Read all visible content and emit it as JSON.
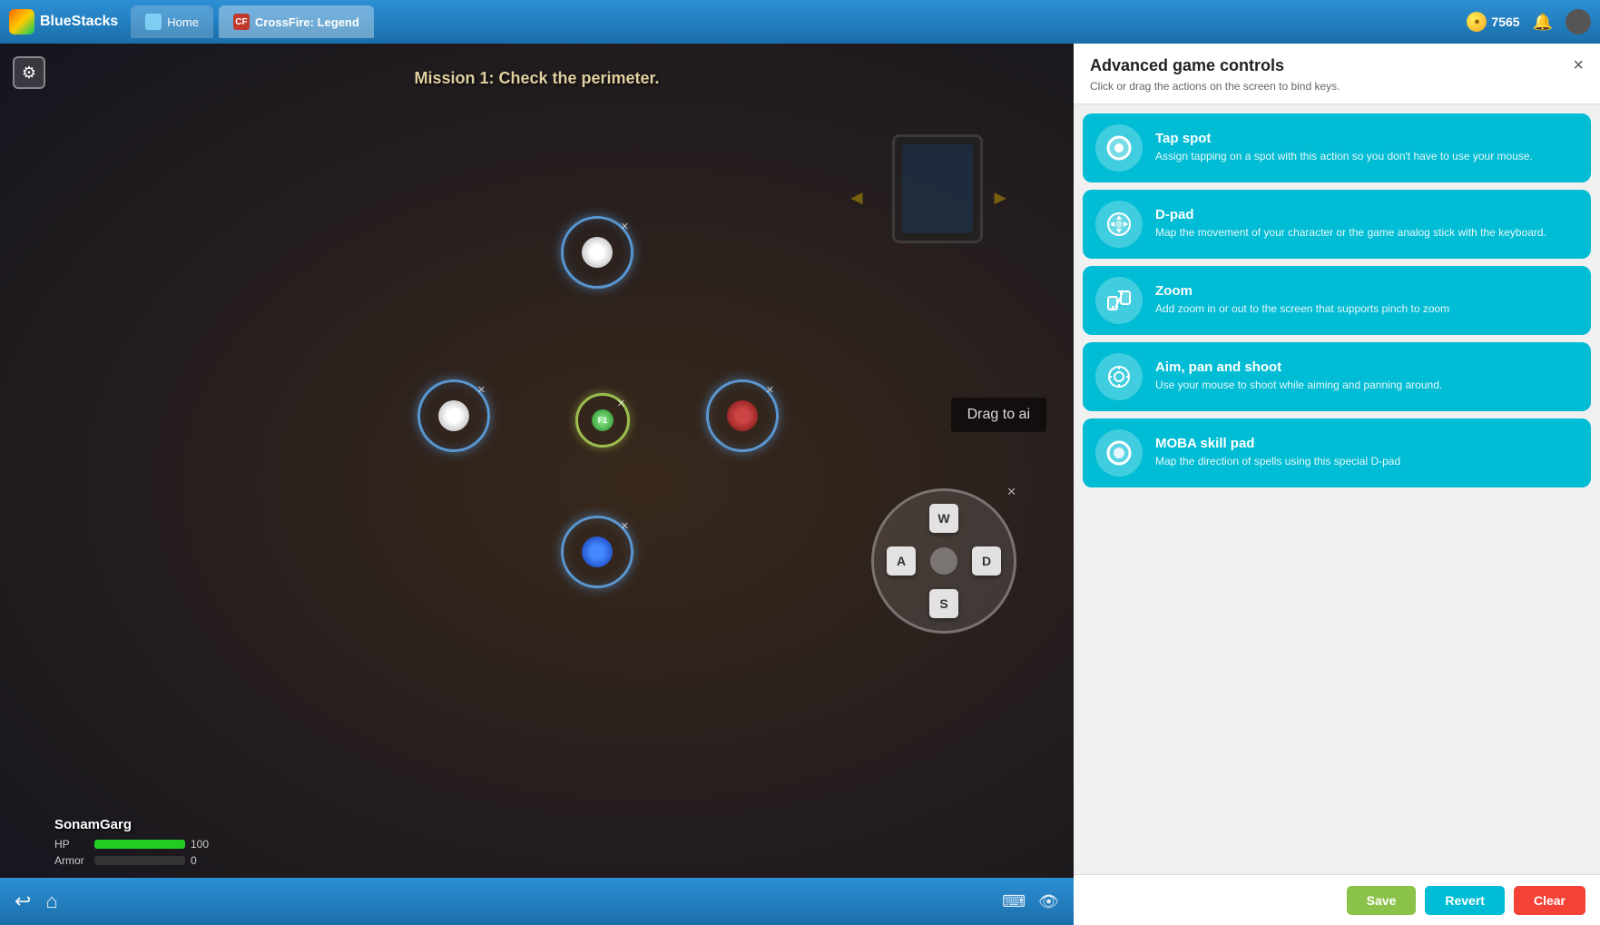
{
  "topbar": {
    "brand": "BlueStacks",
    "tabs": [
      {
        "id": "home",
        "label": "Home"
      },
      {
        "id": "game",
        "label": "CrossFire: Legend"
      }
    ],
    "coins": "7565",
    "coin_icon": "●"
  },
  "game": {
    "mission": "Mission 1: Check the perimeter.",
    "player": {
      "name": "SonamGarg",
      "hp_label": "HP",
      "hp_value": "100",
      "hp_percent": 100,
      "armor_label": "Armor",
      "armor_value": "0",
      "armor_percent": 0
    },
    "drag_banner": "Drag to ai",
    "wasd": {
      "w": "W",
      "a": "A",
      "s": "S",
      "d": "D"
    },
    "tc3_label": "F1"
  },
  "panel": {
    "title": "Advanced game controls",
    "close_label": "×",
    "subtitle": "Click or drag the actions on the screen to bind keys.",
    "controls": [
      {
        "id": "tap-spot",
        "title": "Tap spot",
        "desc": "Assign tapping on a spot with this action so you don't have to use your mouse.",
        "icon_type": "circle"
      },
      {
        "id": "d-pad",
        "title": "D-pad",
        "desc": "Map the movement of your character or the game analog stick with the keyboard.",
        "icon_type": "dpad"
      },
      {
        "id": "zoom",
        "title": "Zoom",
        "desc": "Add zoom in or out to the screen that supports pinch to zoom",
        "icon_type": "zoom"
      },
      {
        "id": "aim-pan-shoot",
        "title": "Aim, pan and shoot",
        "desc": "Use your mouse to shoot while aiming and panning around.",
        "icon_type": "aim"
      },
      {
        "id": "moba-skill",
        "title": "MOBA skill pad",
        "desc": "Map the direction of spells using this special D-pad",
        "icon_type": "moba"
      }
    ],
    "footer": {
      "save_label": "Save",
      "revert_label": "Revert",
      "clear_label": "Clear"
    }
  }
}
